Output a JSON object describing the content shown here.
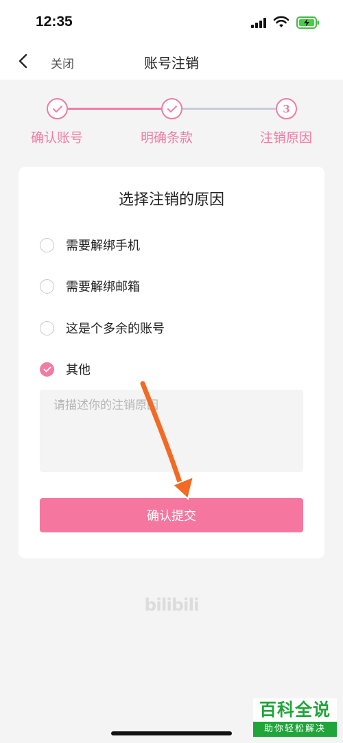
{
  "status_bar": {
    "time": "12:35",
    "icons": [
      "signal-icon",
      "wifi-icon",
      "battery-charging-icon"
    ]
  },
  "nav": {
    "back_icon": "chevron-left-icon",
    "close_label": "关闭",
    "title": "账号注销"
  },
  "stepper": {
    "steps": [
      {
        "label": "确认账号",
        "state": "done"
      },
      {
        "label": "明确条款",
        "state": "done"
      },
      {
        "label": "注销原因",
        "state": "current",
        "number": "3"
      }
    ],
    "colors": {
      "active": "#f07ca3",
      "inactive": "#c9cdd8"
    }
  },
  "form": {
    "title": "选择注销的原因",
    "options": [
      {
        "label": "需要解绑手机",
        "checked": false
      },
      {
        "label": "需要解绑邮箱",
        "checked": false
      },
      {
        "label": "这是个多余的账号",
        "checked": false
      },
      {
        "label": "其他",
        "checked": true
      }
    ],
    "reason_placeholder": "请描述你的注销原因",
    "reason_value": "",
    "submit_label": "确认提交"
  },
  "logo_text": "bilibili",
  "watermark": {
    "title": "百科全说",
    "subtitle": "助你轻松解决"
  },
  "colors": {
    "accent": "#f07ca3",
    "button": "#f5779f",
    "background": "#f4f4f4",
    "watermark_green": "#1fa53a",
    "annotation_arrow": "#f26a23"
  }
}
